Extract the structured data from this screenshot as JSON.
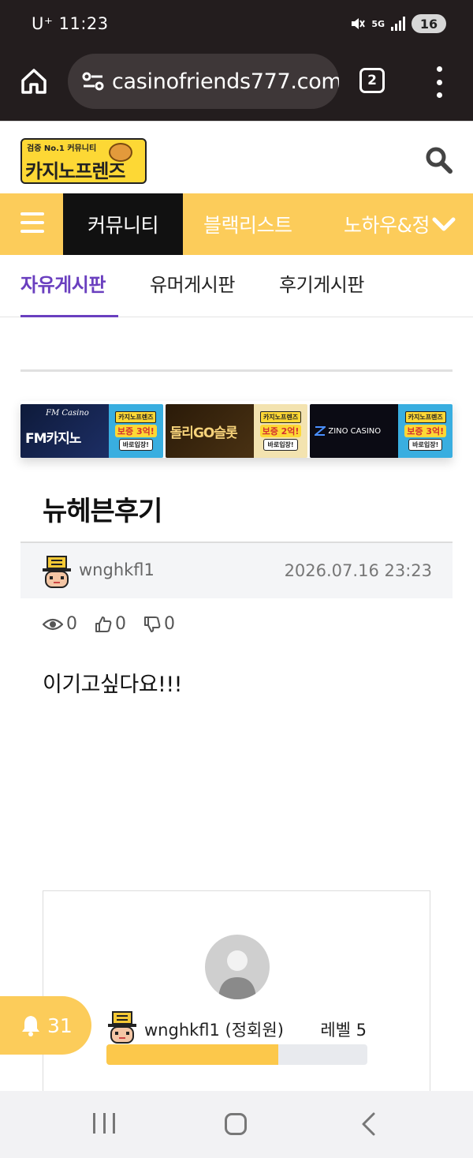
{
  "status_bar": {
    "carrier_time": "U⁺ 11:23",
    "network": "5G",
    "battery": "16"
  },
  "browser": {
    "url": "casinofriends777.com",
    "tab_count": "2"
  },
  "site": {
    "logo_subtitle": "검증 No.1 커뮤니티",
    "logo_text": "카지노프렌즈",
    "brand_color": "#fccc5a",
    "accent_color": "#6a3fbf"
  },
  "main_nav": {
    "items": [
      "커뮤니티",
      "블랙리스트",
      "노하우&정"
    ],
    "active_index": 0
  },
  "sub_tabs": {
    "items": [
      "자유게시판",
      "유머게시판",
      "후기게시판"
    ],
    "active_index": 0
  },
  "banners": [
    {
      "name": "FM카지노",
      "sub": "FM Casino",
      "mini_logo": "카지노프렌즈",
      "bonus": "보증 3억!",
      "cta": "바로입장!"
    },
    {
      "name": "돌리GO슬롯",
      "mini_logo": "카지노프렌즈",
      "bonus": "보증 2억!",
      "cta": "바로입장!"
    },
    {
      "name": "ZINO CASINO",
      "mini_logo": "카지노프렌즈",
      "bonus": "보증 3억!",
      "cta": "바로입장!"
    }
  ],
  "post": {
    "title": "뉴헤븐후기",
    "author": "wnghkfl1",
    "date": "2026.07.16 23:23",
    "views": "0",
    "likes": "0",
    "dislikes": "0",
    "body": "이기고싶다요!!!"
  },
  "author_card": {
    "name": "wnghkfl1 (정회원)",
    "level": "레벨 5",
    "level_progress": 0.66
  },
  "notification": {
    "count": "31"
  }
}
